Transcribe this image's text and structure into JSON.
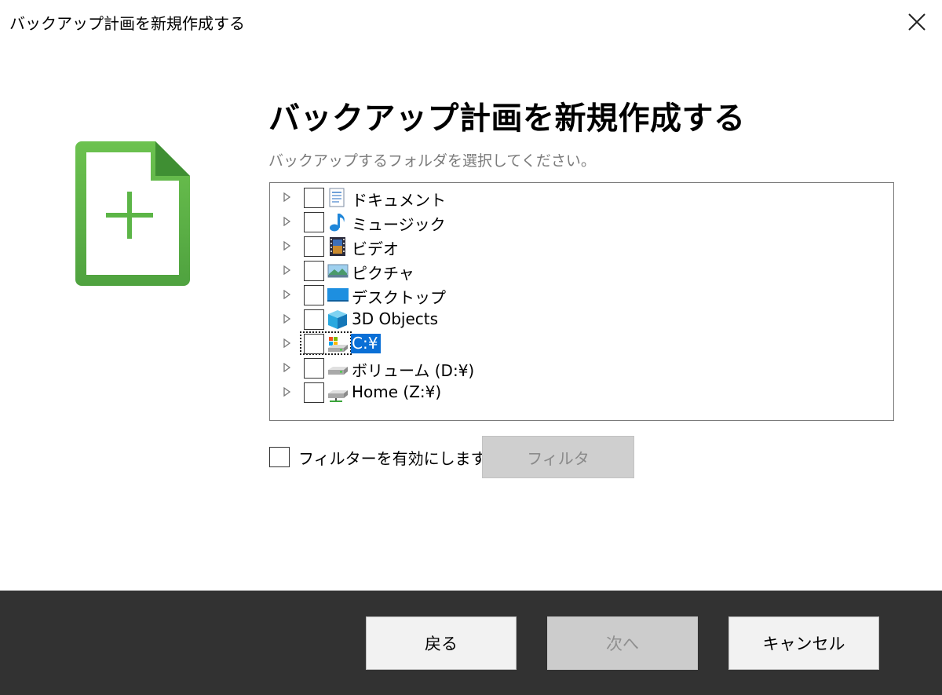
{
  "window": {
    "title": "バックアップ計画を新規作成する",
    "close_icon": "close-icon"
  },
  "main": {
    "heading": "バックアップ計画を新規作成する",
    "instruction": "バックアップするフォルダを選択してください。",
    "icon": "new-document-icon"
  },
  "tree": {
    "items": [
      {
        "label": "ドキュメント",
        "icon": "documents-folder-icon",
        "checked": false,
        "selected": false
      },
      {
        "label": "ミュージック",
        "icon": "music-note-icon",
        "checked": false,
        "selected": false
      },
      {
        "label": "ビデオ",
        "icon": "video-folder-icon",
        "checked": false,
        "selected": false
      },
      {
        "label": "ピクチャ",
        "icon": "pictures-folder-icon",
        "checked": false,
        "selected": false
      },
      {
        "label": "デスクトップ",
        "icon": "desktop-folder-icon",
        "checked": false,
        "selected": false
      },
      {
        "label": "3D Objects",
        "icon": "3d-objects-icon",
        "checked": false,
        "selected": false
      },
      {
        "label": "C:¥",
        "icon": "system-drive-icon",
        "checked": false,
        "selected": true
      },
      {
        "label": "ボリューム (D:¥)",
        "icon": "drive-icon",
        "checked": false,
        "selected": false
      },
      {
        "label": "Home (Z:¥)",
        "icon": "network-drive-icon",
        "checked": false,
        "selected": false
      }
    ]
  },
  "filter": {
    "enable_label": "フィルターを有効にします",
    "enabled": false,
    "button_label": "フィルタ"
  },
  "footer": {
    "back_label": "戻る",
    "next_label": "次へ",
    "cancel_label": "キャンセル"
  },
  "colors": {
    "accent_green": "#5cb547",
    "selection_blue": "#0a6fd6",
    "footer_bg": "#323232"
  }
}
